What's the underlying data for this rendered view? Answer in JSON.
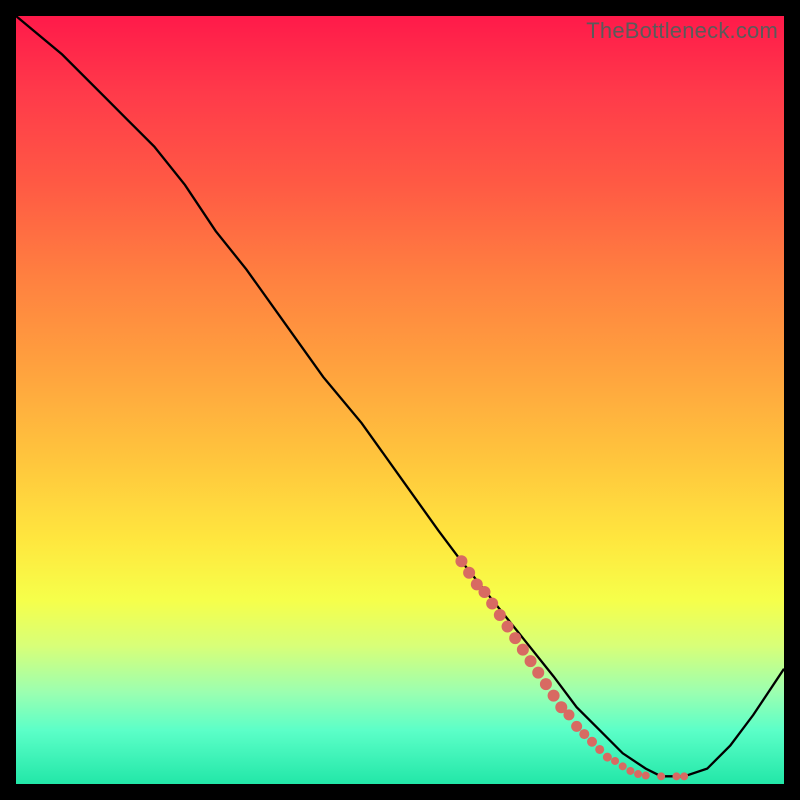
{
  "watermark": "TheBottleneck.com",
  "colors": {
    "line": "#000000",
    "marker_fill": "#d86a62",
    "marker_stroke": "#b8534a",
    "background_black": "#000000"
  },
  "chart_data": {
    "type": "line",
    "title": "",
    "xlabel": "",
    "ylabel": "",
    "xlim": [
      0,
      100
    ],
    "ylim": [
      0,
      100
    ],
    "grid": false,
    "legend": false,
    "axes_visible": false,
    "series": [
      {
        "name": "curve",
        "x": [
          0,
          6,
          12,
          18,
          22,
          26,
          30,
          35,
          40,
          45,
          50,
          55,
          58,
          62,
          66,
          70,
          73,
          76,
          79,
          82,
          84,
          87,
          90,
          93,
          96,
          100
        ],
        "y": [
          100,
          95,
          89,
          83,
          78,
          72,
          67,
          60,
          53,
          47,
          40,
          33,
          29,
          24,
          19,
          14,
          10,
          7,
          4,
          2,
          1,
          1,
          2,
          5,
          9,
          15
        ]
      }
    ],
    "markers": [
      {
        "x": 58,
        "y": 29,
        "size": 6
      },
      {
        "x": 59,
        "y": 27.5,
        "size": 6
      },
      {
        "x": 60,
        "y": 26,
        "size": 6
      },
      {
        "x": 61,
        "y": 25,
        "size": 6
      },
      {
        "x": 62,
        "y": 23.5,
        "size": 6
      },
      {
        "x": 63,
        "y": 22,
        "size": 6
      },
      {
        "x": 64,
        "y": 20.5,
        "size": 6
      },
      {
        "x": 65,
        "y": 19,
        "size": 6
      },
      {
        "x": 66,
        "y": 17.5,
        "size": 6
      },
      {
        "x": 67,
        "y": 16,
        "size": 6
      },
      {
        "x": 68,
        "y": 14.5,
        "size": 6
      },
      {
        "x": 69,
        "y": 13,
        "size": 6
      },
      {
        "x": 70,
        "y": 11.5,
        "size": 6
      },
      {
        "x": 71,
        "y": 10,
        "size": 6
      },
      {
        "x": 72,
        "y": 9,
        "size": 5.5
      },
      {
        "x": 73,
        "y": 7.5,
        "size": 5.5
      },
      {
        "x": 74,
        "y": 6.5,
        "size": 5
      },
      {
        "x": 75,
        "y": 5.5,
        "size": 5
      },
      {
        "x": 76,
        "y": 4.5,
        "size": 4.5
      },
      {
        "x": 77,
        "y": 3.5,
        "size": 4.5
      },
      {
        "x": 78,
        "y": 3,
        "size": 4
      },
      {
        "x": 79,
        "y": 2.3,
        "size": 4
      },
      {
        "x": 80,
        "y": 1.7,
        "size": 4
      },
      {
        "x": 81,
        "y": 1.3,
        "size": 4
      },
      {
        "x": 82,
        "y": 1.1,
        "size": 4
      },
      {
        "x": 84,
        "y": 1.0,
        "size": 4
      },
      {
        "x": 86,
        "y": 1.0,
        "size": 4
      },
      {
        "x": 87,
        "y": 1.0,
        "size": 4
      }
    ]
  }
}
